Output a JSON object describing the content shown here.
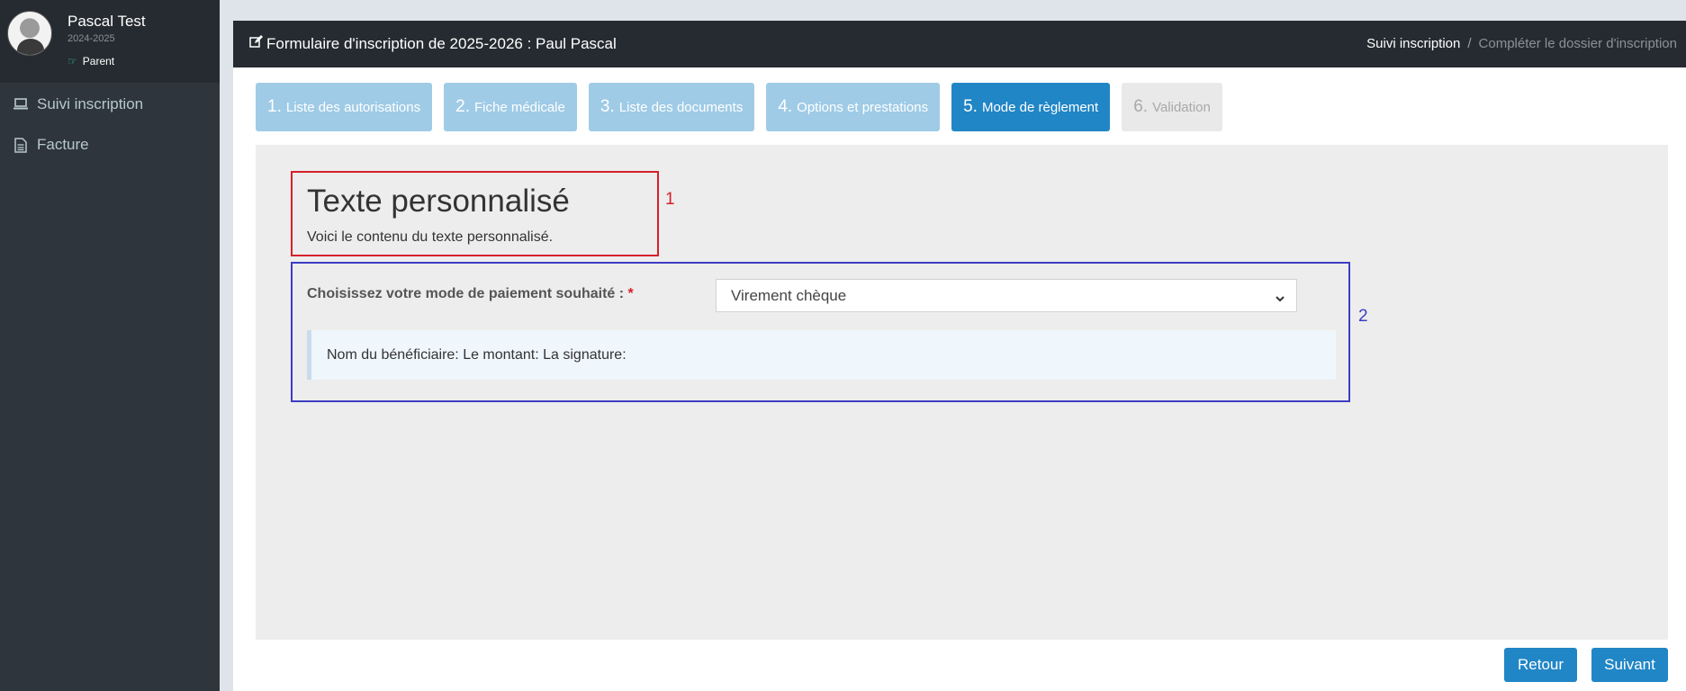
{
  "user": {
    "name": "Pascal Test",
    "year": "2024-2025",
    "role": "Parent"
  },
  "sidebar": {
    "items": [
      {
        "label": "Suivi inscription",
        "icon": "laptop-icon"
      },
      {
        "label": "Facture",
        "icon": "file-text-icon"
      }
    ]
  },
  "header": {
    "title": "Formulaire d'inscription de 2025-2026 : Paul Pascal",
    "breadcrumb": [
      "Suivi inscription",
      "/",
      "Compléter le dossier d'inscription"
    ]
  },
  "steps": [
    {
      "num": "1.",
      "label": "Liste des autorisations",
      "state": "done"
    },
    {
      "num": "2.",
      "label": "Fiche médicale",
      "state": "done"
    },
    {
      "num": "3.",
      "label": "Liste des documents",
      "state": "done"
    },
    {
      "num": "4.",
      "label": "Options et prestations",
      "state": "done"
    },
    {
      "num": "5.",
      "label": "Mode de règlement",
      "state": "active"
    },
    {
      "num": "6.",
      "label": "Validation",
      "state": "disabled"
    }
  ],
  "custom_text": {
    "heading": "Texte personnalisé",
    "body": "Voici le contenu du texte personnalisé.",
    "marker": "1"
  },
  "payment": {
    "label": "Choisissez votre mode de paiement souhaité :",
    "required_mark": "*",
    "selected": "Virement chèque",
    "info": "Nom du bénéficiaire: Le montant: La signature:",
    "marker": "2"
  },
  "buttons": {
    "back": "Retour",
    "next": "Suivant"
  },
  "colors": {
    "primary": "#2186c6",
    "step_done": "#9fcbe6",
    "annotation_red": "#d6202a",
    "annotation_blue": "#3d3dc4",
    "sidebar": "#2e353d"
  }
}
